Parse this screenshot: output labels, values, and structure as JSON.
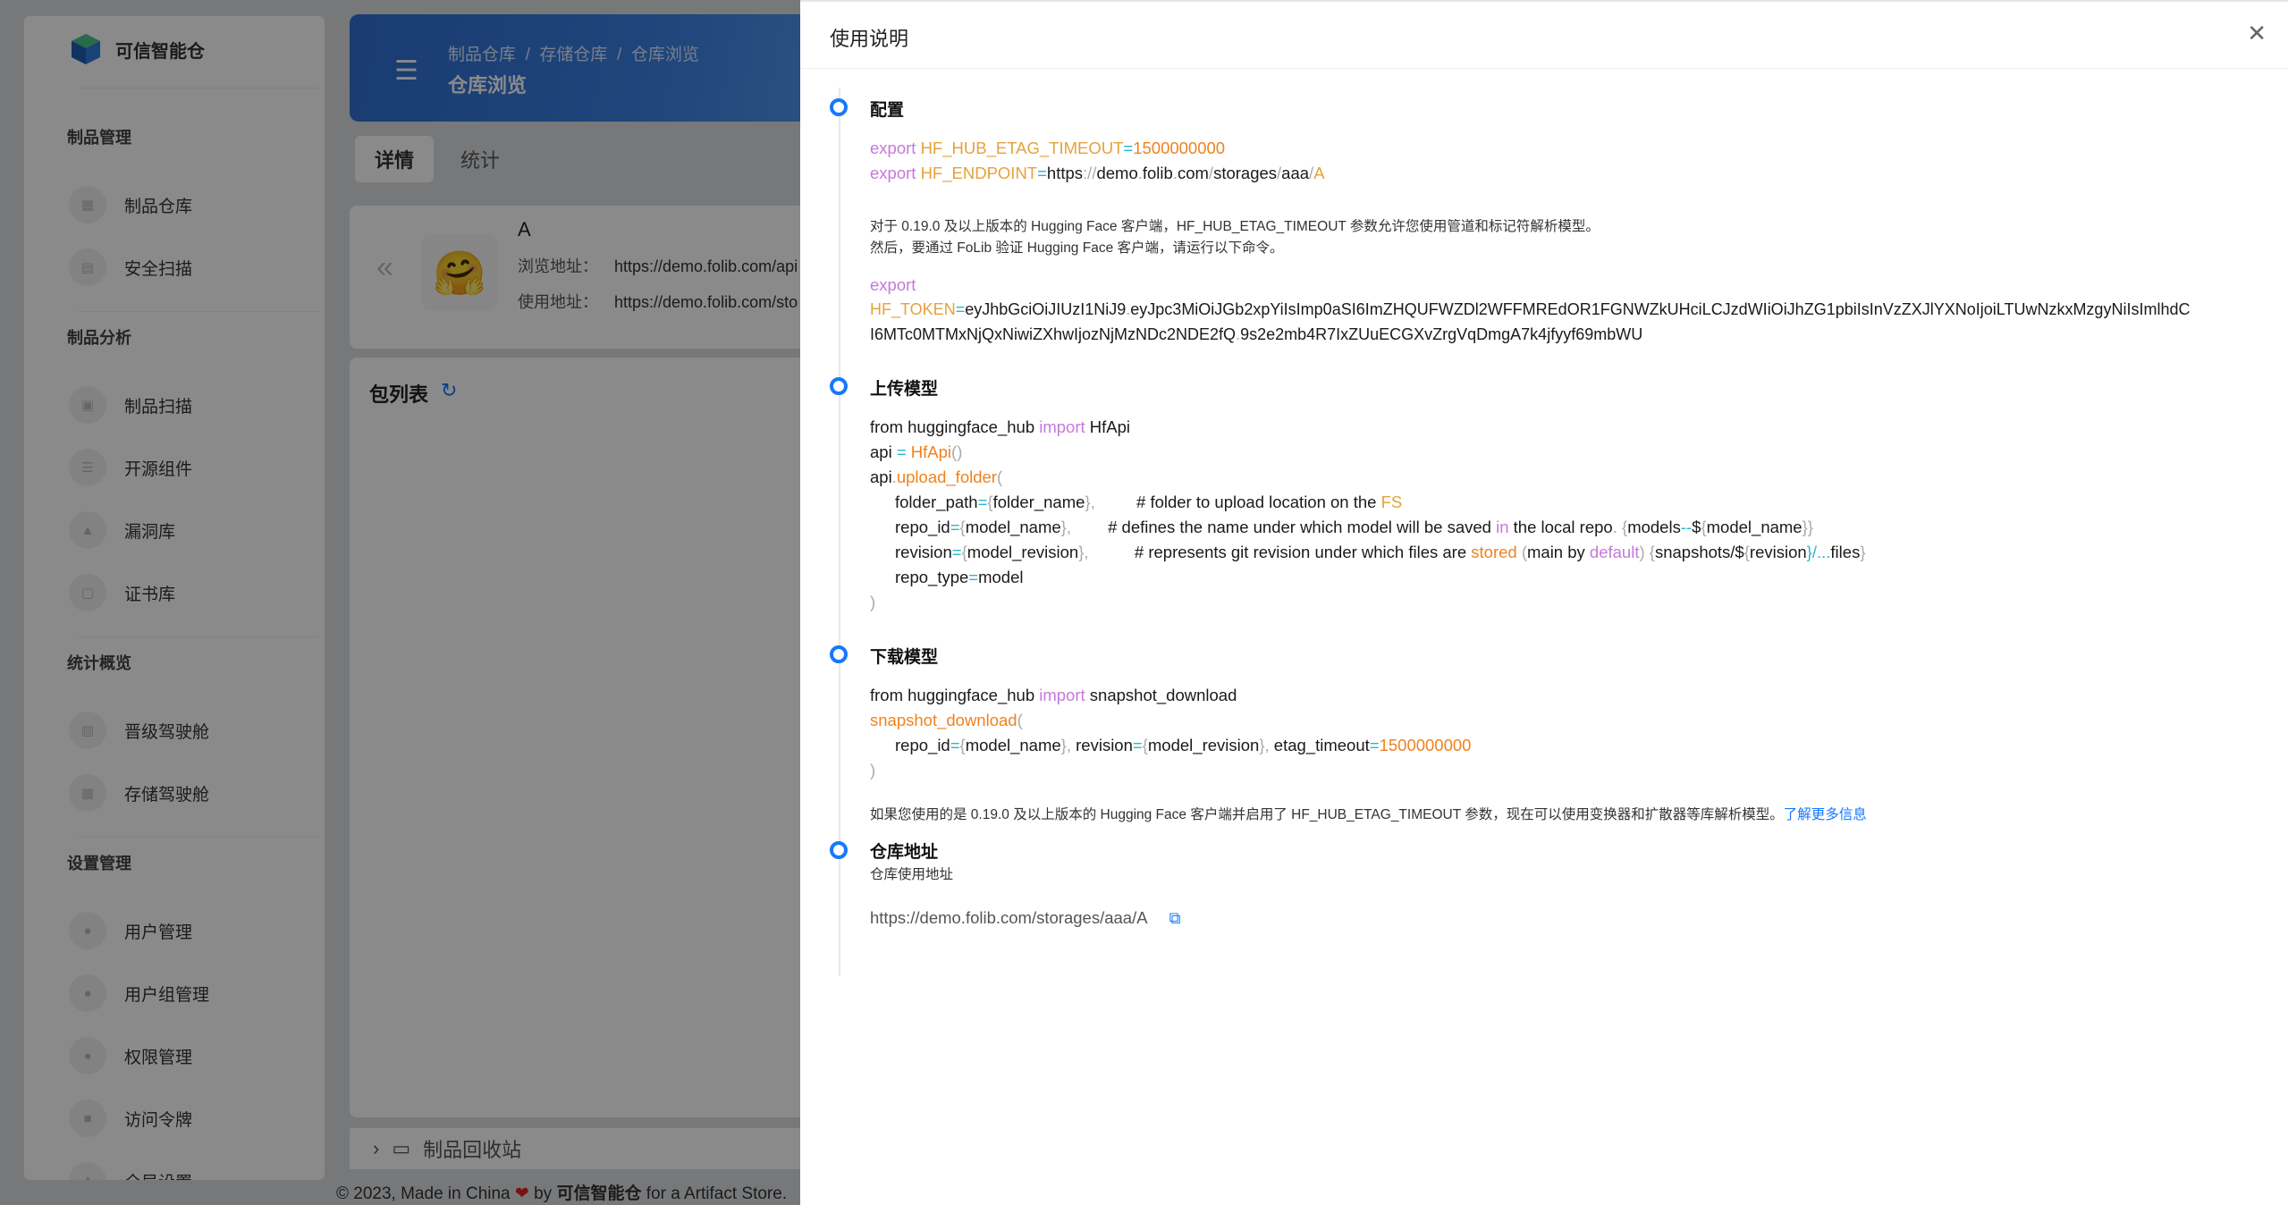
{
  "app": {
    "brand": "可信智能仓"
  },
  "sidebar": {
    "groups": [
      {
        "title": "制品管理",
        "items": [
          "制品仓库",
          "安全扫描"
        ]
      },
      {
        "title": "制品分析",
        "items": [
          "制品扫描",
          "开源组件",
          "漏洞库",
          "证书库"
        ]
      },
      {
        "title": "统计概览",
        "items": [
          "晋级驾驶舱",
          "存储驾驶舱"
        ]
      },
      {
        "title": "设置管理",
        "items": [
          "用户管理",
          "用户组管理",
          "权限管理",
          "访问令牌",
          "全局设置"
        ]
      }
    ]
  },
  "header": {
    "breadcrumb": [
      "制品仓库",
      "存储仓库",
      "仓库浏览"
    ],
    "title": "仓库浏览"
  },
  "tabs": [
    "详情",
    "统计"
  ],
  "repo": {
    "name": "A",
    "browse_label": "浏览地址：",
    "browse_url": "https://demo.folib.com/api",
    "use_label": "使用地址：",
    "use_url": "https://demo.folib.com/sto"
  },
  "packages": {
    "title": "包列表"
  },
  "recycle": {
    "label": "制品回收站"
  },
  "footer": {
    "prefix": "© 2023, Made in China",
    "by": "by",
    "brand": "可信智能仓",
    "suffix": "for a Artifact Store."
  },
  "drawer": {
    "title": "使用说明",
    "sections": {
      "config": {
        "title": "配置",
        "l1": {
          "kw": "export",
          "var": "HF_HUB_ETAG_TIMEOUT",
          "eq": "=",
          "val": "1500000000"
        },
        "l2": {
          "kw": "export",
          "var": "HF_ENDPOINT",
          "eq": "=",
          "p1": "https",
          "p2": "://",
          "p3": "demo",
          "p4": ".",
          "p5": "folib",
          "p6": ".",
          "p7": "com",
          "p8": "/",
          "p9": "storages",
          "p10": "/",
          "p11": "aaa",
          "p12": "/",
          "p13": "A"
        },
        "note1": "对于 0.19.0 及以上版本的 Hugging Face 客户端，HF_HUB_ETAG_TIMEOUT 参数允许您使用管道和标记符解析模型。",
        "note2": "然后，要通过 FoLib 验证 Hugging Face 客户端，请运行以下命令。",
        "token_kw": "export",
        "token_var": "HF_TOKEN",
        "token_eq": "=",
        "token_a": "eyJhbGciOiJIUzI1NiJ9",
        "token_dot1": ".",
        "token_b": "eyJpc3MiOiJGb2xpYiIsImp0aSI6ImZHQUFWZDl2WFFMREdOR1FGNWZkUHciLCJzdWIiOiJhZG1pbiIsInVzZXJlYXNoIjoiLTUwNzkxMzgyNiIsImlhdC",
        "token_c": "I6MTc0MTMxNjQxNiwiZXhwIjozNjMzNDc2NDE2fQ",
        "token_dot2": ".",
        "token_d": "9s2e2mb4R7IxZUuECGXvZrgVqDmgA7k4jfyyf69mbWU"
      },
      "upload": {
        "title": "上传模型",
        "l1a": "from huggingface_hub ",
        "l1kw": "import",
        "l1b": " HfApi",
        "l2a": "api ",
        "l2eq": "=",
        "l2b": " HfApi",
        "l2c": "()",
        "l3a": "api",
        "l3dot": ".",
        "l3b": "upload_folder",
        "l3c": "(",
        "f1a": "folder_path",
        "f1eq": "=",
        "f1b": "{",
        "f1c": "folder_name",
        "f1d": "},",
        "f1e": "         # folder to upload location on the ",
        "f1f": "FS",
        "f2a": "repo_id",
        "f2eq": "=",
        "f2b": "{",
        "f2c": "model_name",
        "f2d": "},",
        "f2e": "        # defines the name under which model will be saved ",
        "f2kw": "in",
        "f2f": " the local repo",
        "f2g": ". {",
        "f2h": "models",
        "f2i": "--",
        "f2j": "$",
        "f2k": "{",
        "f2l": "model_name",
        "f2m": "}}",
        "f3a": "revision",
        "f3eq": "=",
        "f3b": "{",
        "f3c": "model_revision",
        "f3d": "},",
        "f3e": "          # represents git revision under which files are ",
        "f3f": "stored",
        "f3g": " (",
        "f3h": "main by ",
        "f3kw": "default",
        "f3i": ") {",
        "f3j": "snapshots",
        "f3k": "/$",
        "f3l": "{",
        "f3m": "revision",
        "f3n": "}/...",
        "f3o": "files",
        "f3p": "}",
        "f4a": "repo_type",
        "f4eq": "=",
        "f4b": "model",
        "close": ")"
      },
      "download": {
        "title": "下载模型",
        "l1a": "from huggingface_hub ",
        "l1kw": "import",
        "l1b": " snapshot_download",
        "l2a": "snapshot_download",
        "l2b": "(",
        "p1": "repo_id",
        "p1eq": "=",
        "p1b": "{",
        "p1c": "model_name",
        "p1d": "}, ",
        "p2": "revision",
        "p2eq": "=",
        "p2b": "{",
        "p2c": "model_revision",
        "p2d": "}, ",
        "p3": "etag_timeout",
        "p3eq": "=",
        "p3v": "1500000000",
        "close": ")",
        "note": "如果您使用的是 0.19.0 及以上版本的 Hugging Face 客户端并启用了 HF_HUB_ETAG_TIMEOUT 参数，现在可以使用变换器和扩散器等库解析模型。",
        "link": "了解更多信息"
      },
      "address": {
        "title": "仓库地址",
        "subtitle": "仓库使用地址",
        "url": "https://demo.folib.com/storages/aaa/A"
      }
    }
  }
}
